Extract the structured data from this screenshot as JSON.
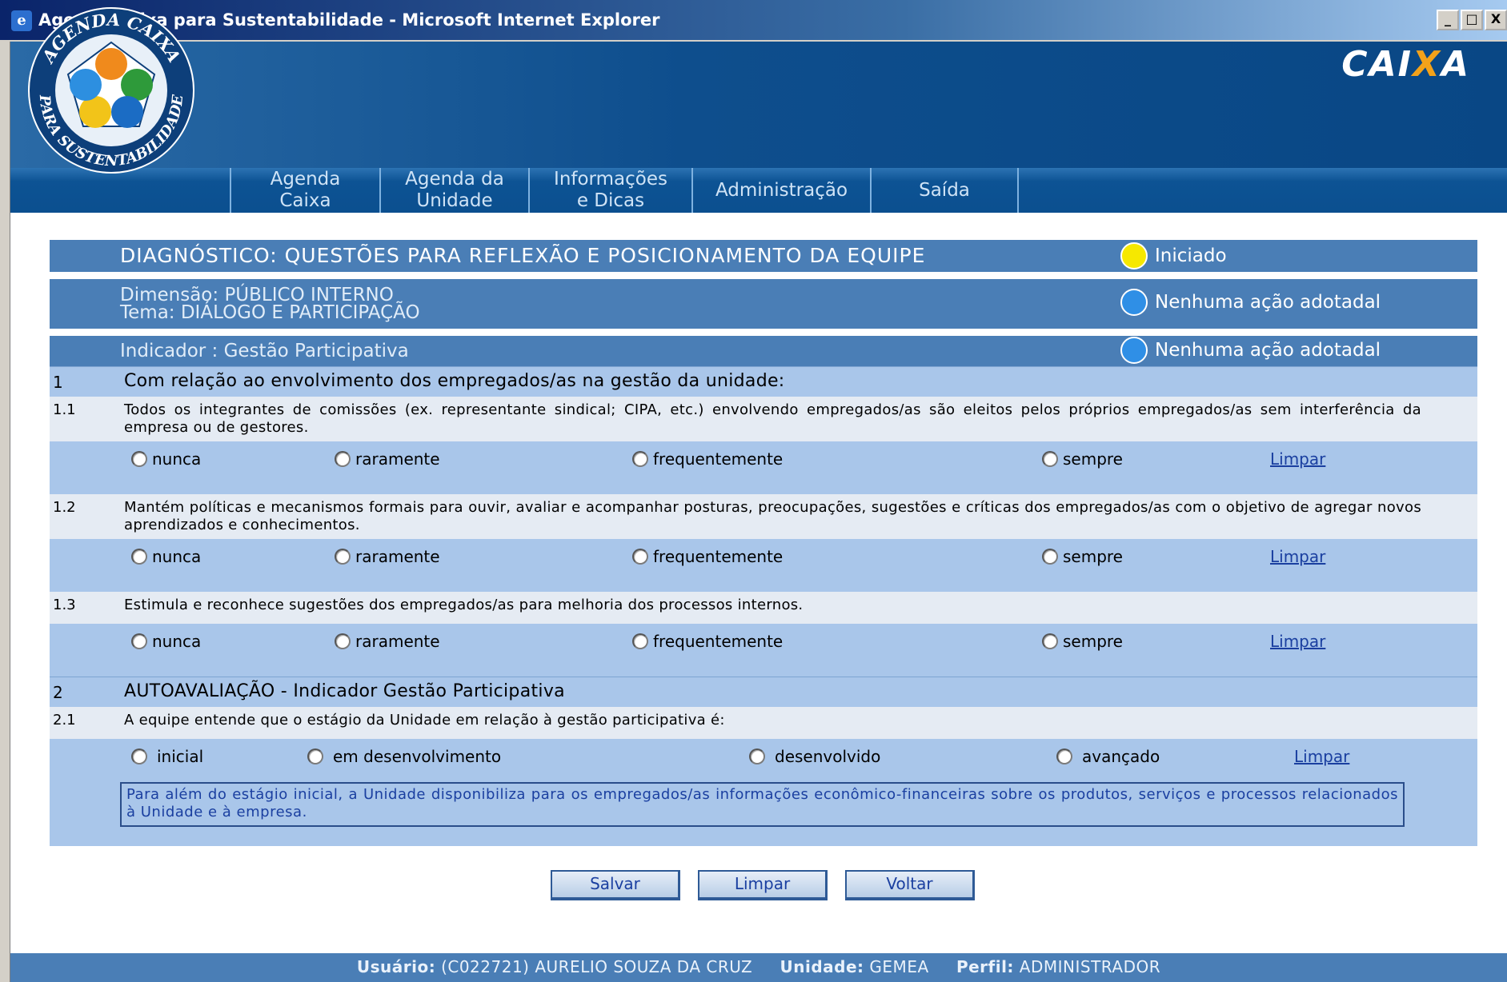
{
  "window": {
    "title": "Agenda Caixa para Sustentabilidade - Microsoft Internet Explorer",
    "buttons": [
      "_",
      "□",
      "X"
    ]
  },
  "brand": {
    "logo_text": "CAIXA",
    "logo_text_a": "CAI",
    "logo_text_x": "X",
    "logo_text_b": "A",
    "agenda_logo_top": "AGENDA CAIXA",
    "agenda_logo_bottom": "PARA SUSTENTABILIDADE"
  },
  "nav": {
    "items": [
      {
        "line1": "Agenda",
        "line2": "Caixa"
      },
      {
        "line1": "Agenda da",
        "line2": "Unidade"
      },
      {
        "line1": "Informações",
        "line2": "e Dicas"
      },
      {
        "line1": "Administração",
        "line2": ""
      },
      {
        "line1": "Saída",
        "line2": ""
      }
    ]
  },
  "header": {
    "title": "DIAGNÓSTICO: QUESTÕES PARA REFLEXÃO E POSICIONAMENTO DA EQUIPE",
    "title_status": "Iniciado",
    "dimension": "Dimensão: PÚBLICO INTERNO",
    "theme": "Tema: DIÁLOGO E PARTICIPAÇÃO",
    "dimension_status": "Nenhuma ação adotadal",
    "indicator": "Indicador : Gestão Participativa",
    "indicator_status": "Nenhuma ação adotadal",
    "colors": {
      "iniciado": "#f6e800",
      "nenhuma": "#2f8fe6"
    }
  },
  "sections": [
    {
      "num": "1",
      "title": "Com relação ao envolvimento dos empregados/as na gestão da unidade:",
      "questions": [
        {
          "num": "1.1",
          "text": "Todos os integrantes de comissões (ex. representante sindical; CIPA, etc.) envolvendo empregados/as são eleitos pelos próprios empregados/as sem interferência da empresa ou de gestores.",
          "options": [
            "nunca",
            "raramente",
            "frequentemente",
            "sempre"
          ],
          "clear": "Limpar"
        },
        {
          "num": "1.2",
          "text": "Mantém políticas e mecanismos formais para ouvir, avaliar e acompanhar posturas, preocupações, sugestões e críticas dos empregados/as com o objetivo de agregar novos aprendizados e conhecimentos.",
          "options": [
            "nunca",
            "raramente",
            "frequentemente",
            "sempre"
          ],
          "clear": "Limpar"
        },
        {
          "num": "1.3",
          "text": "Estimula e reconhece sugestões dos empregados/as para melhoria dos processos internos.",
          "options": [
            "nunca",
            "raramente",
            "frequentemente",
            "sempre"
          ],
          "clear": "Limpar"
        }
      ]
    },
    {
      "num": "2",
      "title": "AUTOAVALIAÇÃO - Indicador Gestão Participativa",
      "questions": [
        {
          "num": "2.1",
          "text": "A equipe entende que o estágio da Unidade em relação à gestão participativa é:",
          "options": [
            "inicial",
            "em desenvolvimento",
            "desenvolvido",
            "avançado"
          ],
          "clear": "Limpar",
          "note": "Para além do estágio inicial, a Unidade disponibiliza para os empregados/as informações econômico-financeiras sobre os produtos, serviços e processos relacionados à Unidade e à empresa."
        }
      ]
    }
  ],
  "buttons": {
    "save": "Salvar",
    "clear": "Limpar",
    "back": "Voltar"
  },
  "footer": {
    "user_label": "Usuário:",
    "user_value": "(C022721) AURELIO SOUZA DA CRUZ",
    "unit_label": "Unidade:",
    "unit_value": "GEMEA",
    "profile_label": "Perfil:",
    "profile_value": "ADMINISTRADOR"
  }
}
